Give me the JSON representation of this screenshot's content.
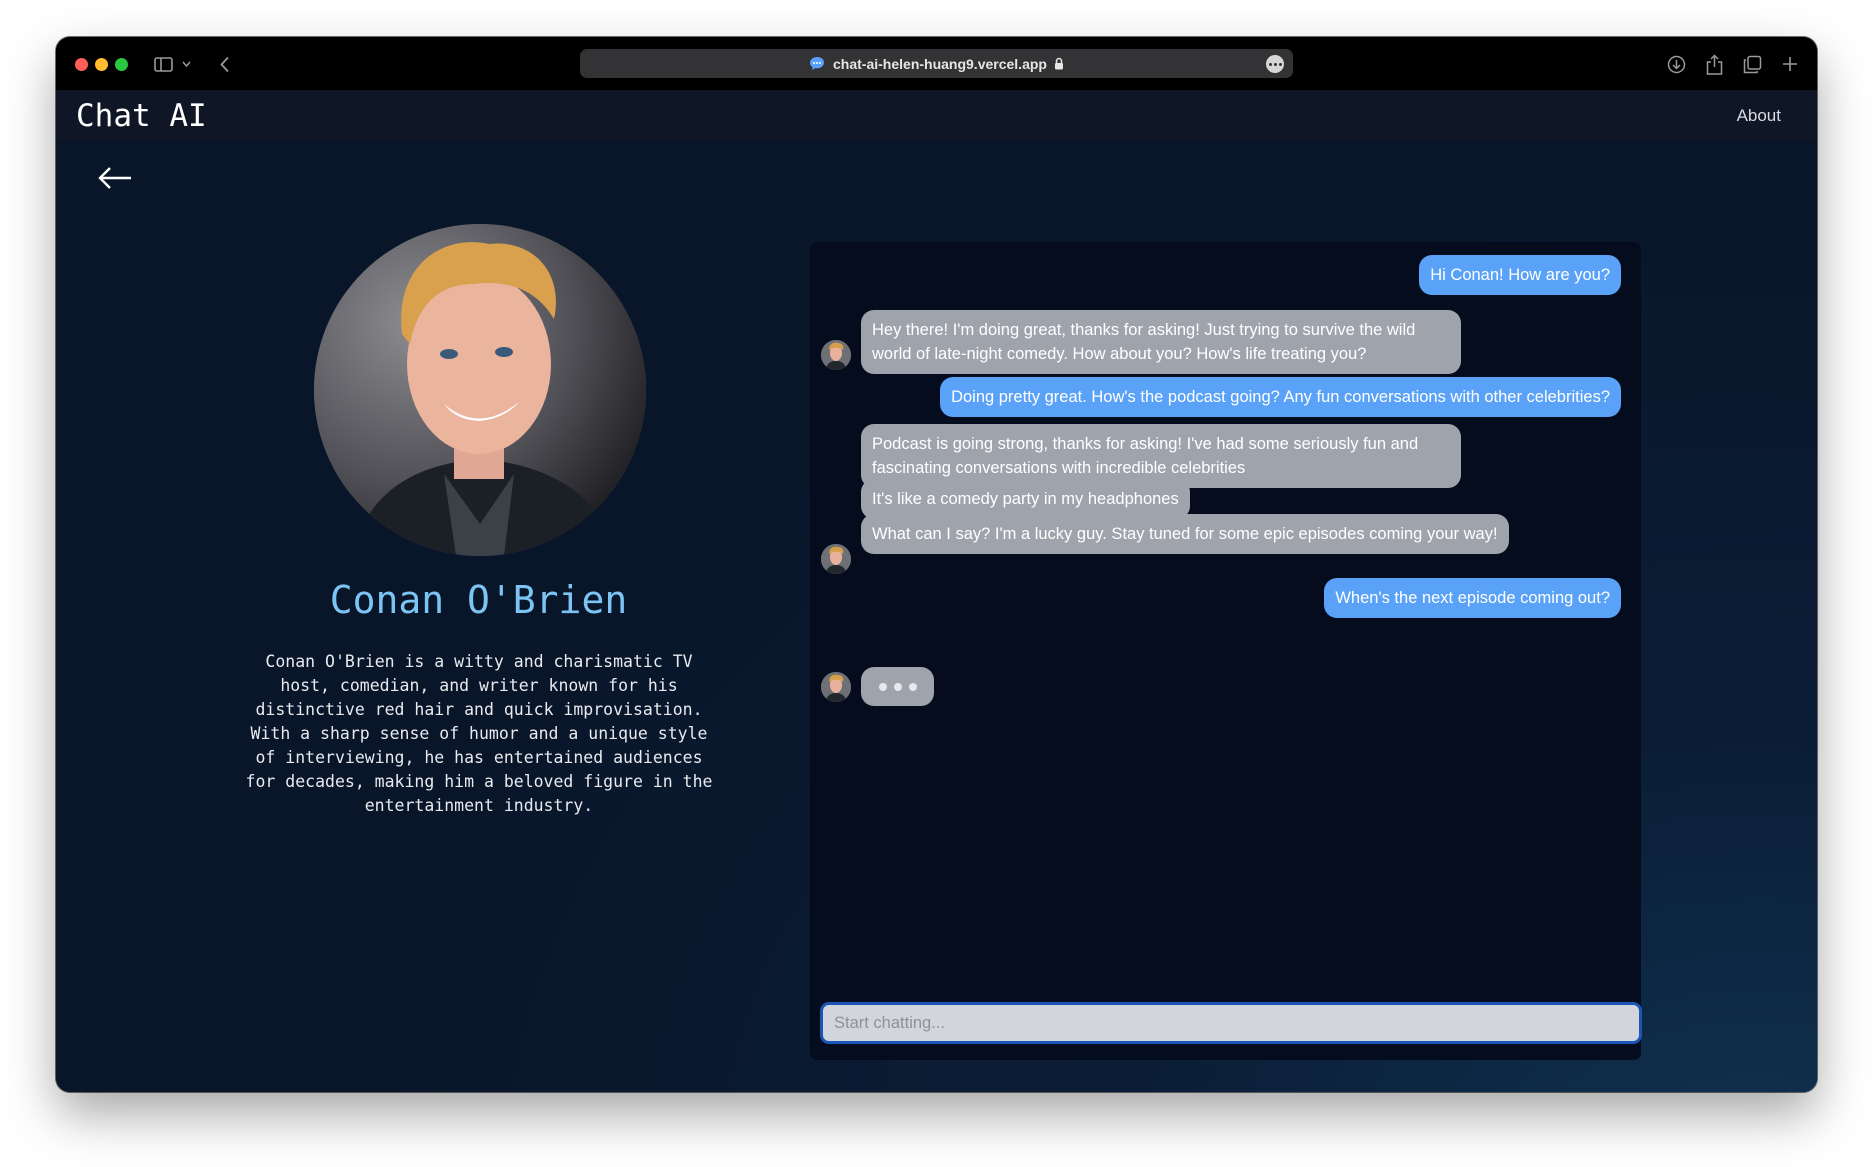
{
  "browser": {
    "url": "chat-ai-helen-huang9.vercel.app",
    "icons": [
      "sidebar-toggle-icon",
      "chevron-down-icon",
      "back-chevron-icon",
      "chat-bubble-favicon",
      "lock-icon",
      "more-icon",
      "download-icon",
      "share-icon",
      "tabs-icon",
      "plus-icon"
    ]
  },
  "navbar": {
    "brand": "Chat AI",
    "about": "About"
  },
  "profile": {
    "name": "Conan O'Brien",
    "bio": "Conan O'Brien is a witty and charismatic TV host, comedian, and writer known for his distinctive red hair and quick improvisation. With a sharp sense of humor and a unique style of interviewing, he has entertained audiences for decades, making him a beloved figure in the entertainment industry."
  },
  "chat": {
    "messages": [
      {
        "role": "user",
        "text": "Hi Conan! How are you?"
      },
      {
        "role": "bot",
        "text": "Hey there! I'm doing great, thanks for asking! Just trying to survive the wild world of late-night comedy. How about you? How's life treating you?"
      },
      {
        "role": "user",
        "text": "Doing pretty great. How's the podcast going? Any fun conversations with other celebrities?"
      },
      {
        "role": "bot",
        "text": "Podcast is going strong, thanks for asking! I've had some seriously fun and fascinating conversations with incredible celebrities"
      },
      {
        "role": "bot",
        "text": "It's like a comedy party in my headphones"
      },
      {
        "role": "bot",
        "text": "What can I say? I'm a lucky guy. Stay tuned for some epic episodes coming your way!"
      },
      {
        "role": "user",
        "text": "When's the next episode coming out?"
      }
    ],
    "typing": true,
    "input_placeholder": "Start chatting..."
  },
  "colors": {
    "user_bubble": "#5aa2f7",
    "bot_bubble": "#9fa3ac",
    "name_accent": "#7cc4f4",
    "input_border": "#1b56b6"
  }
}
